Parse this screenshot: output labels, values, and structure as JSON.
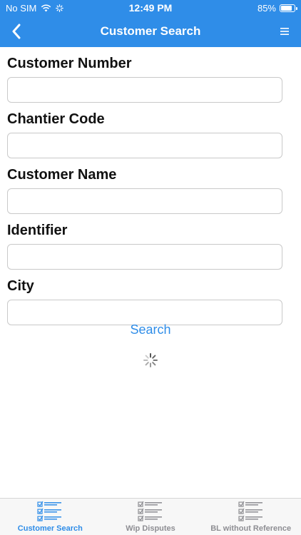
{
  "status_bar": {
    "carrier": "No SIM",
    "time": "12:49 PM",
    "battery_text": "85%",
    "battery_level": 0.85
  },
  "nav": {
    "title": "Customer Search",
    "back_icon": "chevron-left-icon",
    "menu_icon": "hamburger-menu-icon"
  },
  "form": {
    "fields": [
      {
        "label": "Customer Number",
        "value": ""
      },
      {
        "label": "Chantier Code",
        "value": ""
      },
      {
        "label": "Customer Name",
        "value": ""
      },
      {
        "label": "Identifier",
        "value": ""
      },
      {
        "label": "City",
        "value": ""
      }
    ],
    "search_label": "Search"
  },
  "tabs": [
    {
      "label": "Customer Search",
      "icon": "checklist-icon",
      "active": true
    },
    {
      "label": "Wip Disputes",
      "icon": "checklist-icon",
      "active": false
    },
    {
      "label": "BL without Reference",
      "icon": "checklist-icon",
      "active": false
    }
  ],
  "colors": {
    "accent": "#2f8de8",
    "inactive": "#8e8e93"
  }
}
